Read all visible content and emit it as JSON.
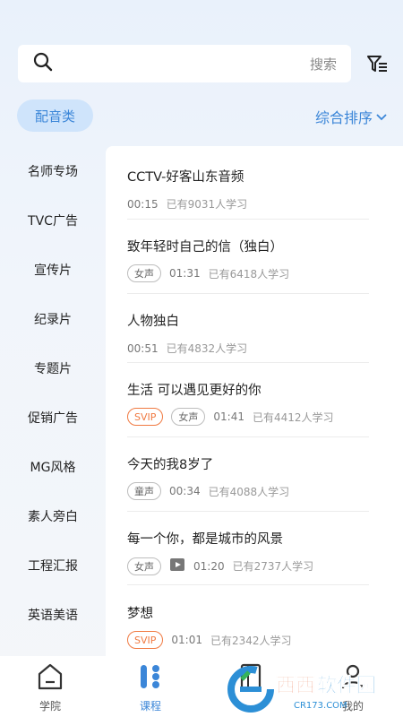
{
  "search": {
    "hint": "搜索"
  },
  "category": {
    "label": "配音类"
  },
  "sort": {
    "label": "综合排序"
  },
  "sidebar": {
    "items": [
      "名师专场",
      "TVC广告",
      "宣传片",
      "纪录片",
      "专题片",
      "促销广告",
      "MG风格",
      "素人旁白",
      "工程汇报",
      "英语美语"
    ]
  },
  "list": [
    {
      "title": "CCTV-好客山东音频",
      "time": "00:15",
      "learners": "已有9031人学习"
    },
    {
      "title": "致年轻时自己的信（独白）",
      "tags": [
        "女声"
      ],
      "time": "01:31",
      "learners": "已有6418人学习"
    },
    {
      "title": "人物独白",
      "time": "00:51",
      "learners": "已有4832人学习"
    },
    {
      "title": "生活  可以遇见更好的你",
      "tags": [
        "SVIP",
        "女声"
      ],
      "time": "01:41",
      "learners": "已有4412人学习"
    },
    {
      "title": "今天的我8岁了",
      "tags": [
        "童声"
      ],
      "time": "00:34",
      "learners": "已有4088人学习"
    },
    {
      "title": "每一个你，都是城市的风景",
      "tags": [
        "女声"
      ],
      "video": true,
      "time": "01:20",
      "learners": "已有2737人学习"
    },
    {
      "title": "梦想",
      "tags": [
        "SVIP"
      ],
      "time": "01:01",
      "learners": "已有2342人学习"
    }
  ],
  "tabs": {
    "academy": "学院",
    "courses": "课程",
    "mine": "我的"
  },
  "watermark": {
    "text": "西西软件园",
    "url": "CR173.COM"
  },
  "colors": {
    "accent": "#3b86d8",
    "svip": "#f07a42"
  }
}
